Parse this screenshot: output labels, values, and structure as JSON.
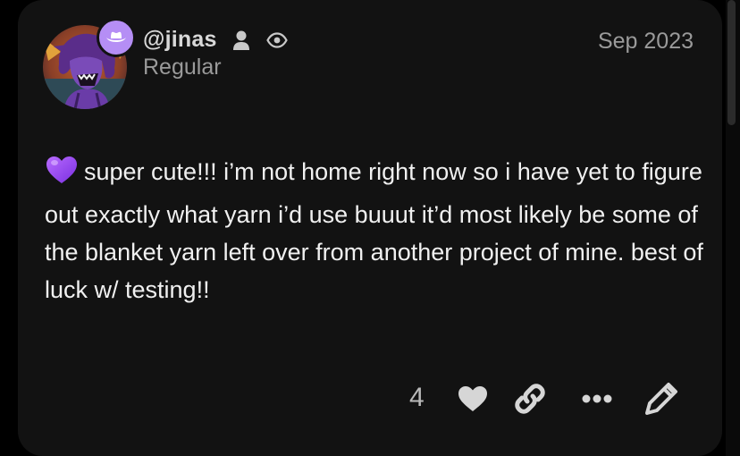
{
  "post": {
    "author": {
      "username": "@jinas",
      "title": "Regular",
      "flair_icon": "cowboy-hat-icon",
      "flair_color": "#b58ef5"
    },
    "date": "Sep 2023",
    "body": {
      "emoji": "purple-heart",
      "text": "super cute!!! i’m not home right now so i have yet to figure out exactly what yarn i’d use buuut it’d most likely be some of the blanket yarn left over from another project of mine. best of luck w/ testing!!"
    },
    "actions": {
      "like_count": "4",
      "icons": [
        "heart-icon",
        "link-icon",
        "more-icon",
        "edit-icon"
      ]
    }
  },
  "colors": {
    "background": "#000000",
    "card": "#121212",
    "text_primary": "#f0f0f0",
    "text_secondary": "#9a9a9a",
    "accent_purple": "#b58ef5",
    "icon": "#d6d6d6"
  }
}
